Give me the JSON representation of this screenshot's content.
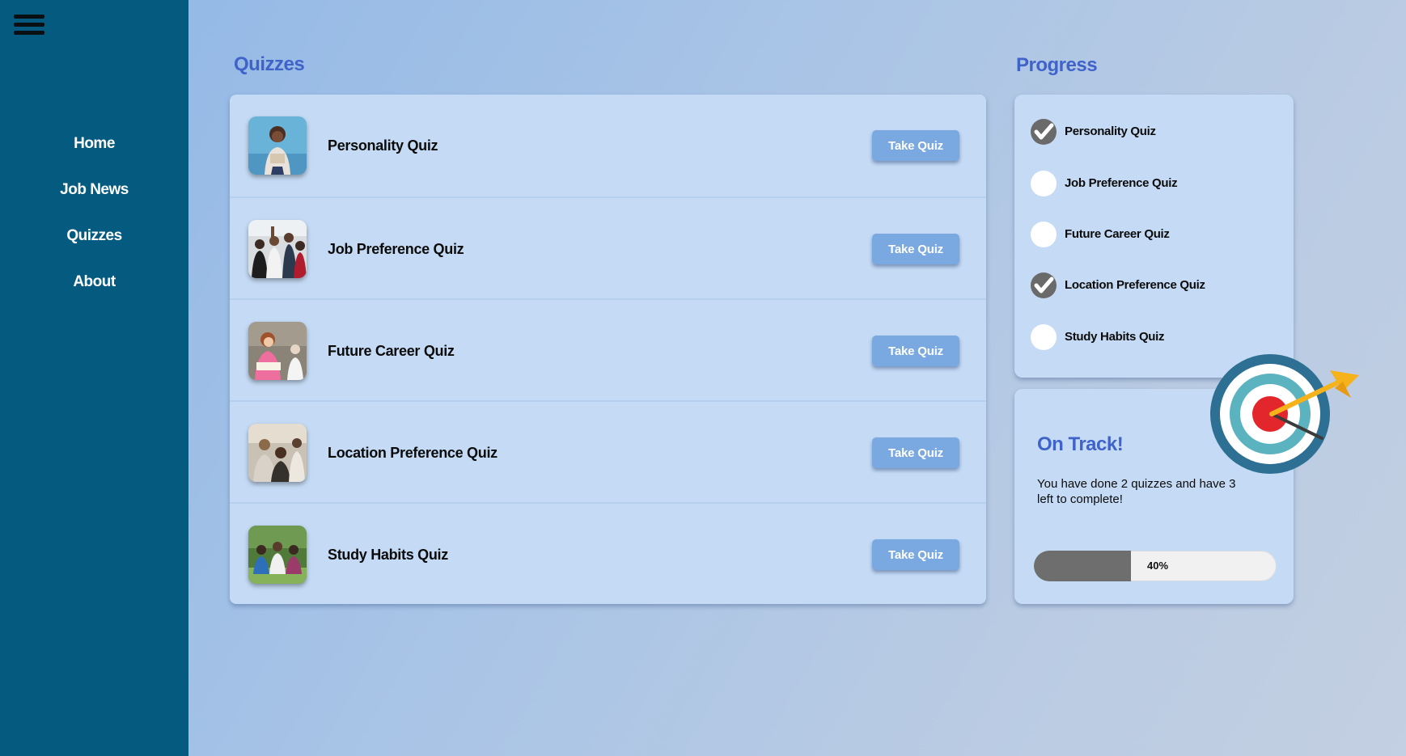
{
  "sidebar": {
    "menu_icon": "hamburger-menu-icon",
    "items": [
      {
        "label": "Home"
      },
      {
        "label": "Job News"
      },
      {
        "label": "Quizzes"
      },
      {
        "label": "About"
      }
    ]
  },
  "quizzes": {
    "title": "Quizzes",
    "button_label": "Take Quiz",
    "items": [
      {
        "name": "Personality Quiz",
        "icon": "photo-thumbnail"
      },
      {
        "name": "Job Preference Quiz",
        "icon": "photo-thumbnail"
      },
      {
        "name": "Future Career Quiz",
        "icon": "photo-thumbnail"
      },
      {
        "name": "Location Preference Quiz",
        "icon": "photo-thumbnail"
      },
      {
        "name": "Study Habits Quiz",
        "icon": "photo-thumbnail"
      }
    ]
  },
  "progress": {
    "title": "Progress",
    "items": [
      {
        "name": "Personality Quiz",
        "completed": true
      },
      {
        "name": "Job Preference Quiz",
        "completed": false
      },
      {
        "name": "Future Career Quiz",
        "completed": false
      },
      {
        "name": "Location Preference Quiz",
        "completed": true
      },
      {
        "name": "Study Habits Quiz",
        "completed": false
      }
    ]
  },
  "status": {
    "title": "On Track!",
    "message": "You have done 2 quizzes and have 3 left to complete!",
    "progress_label": "40%",
    "progress_fraction": 0.4,
    "icon": "target-arrow-icon"
  },
  "colors": {
    "sidebar": "#055a80",
    "accent": "#3f63c9",
    "button": "#7aa8e0",
    "panel": "#c5dbf5"
  }
}
